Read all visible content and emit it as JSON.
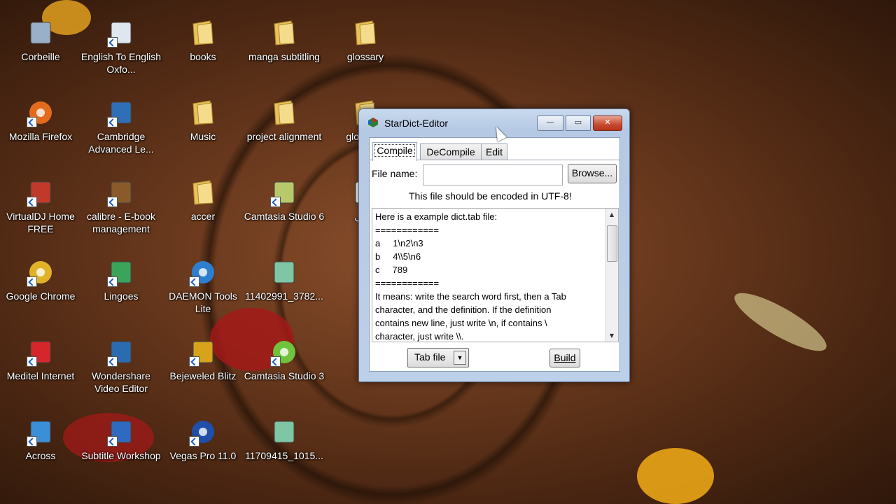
{
  "desktop": {
    "icons": [
      {
        "label": "Corbeille",
        "icon": "recycle-bin-icon",
        "shortcut": false
      },
      {
        "label": "English To English Oxfo...",
        "icon": "dictionary-icon",
        "shortcut": true
      },
      {
        "label": "books",
        "icon": "folder-icon",
        "shortcut": false
      },
      {
        "label": "manga subtitling",
        "icon": "folder-icon",
        "shortcut": false
      },
      {
        "label": "glossary",
        "icon": "folder-icon",
        "shortcut": false
      },
      {
        "label": "Mozilla Firefox",
        "icon": "firefox-icon",
        "shortcut": true
      },
      {
        "label": "Cambridge Advanced Le...",
        "icon": "cald3-icon",
        "shortcut": true
      },
      {
        "label": "Music",
        "icon": "folder-icon",
        "shortcut": false
      },
      {
        "label": "project alignment",
        "icon": "folder-icon",
        "shortcut": false
      },
      {
        "label": "glo assig",
        "icon": "folder-icon",
        "shortcut": false
      },
      {
        "label": "VirtualDJ Home FREE",
        "icon": "virtualdj-icon",
        "shortcut": true
      },
      {
        "label": "calibre - E-book management",
        "icon": "calibre-icon",
        "shortcut": true
      },
      {
        "label": "accer",
        "icon": "folder-icon",
        "shortcut": false
      },
      {
        "label": "Camtasia Studio 6",
        "icon": "camtasia-icon",
        "shortcut": true
      },
      {
        "label": "عربي",
        "icon": "file-icon",
        "shortcut": false
      },
      {
        "label": "Google Chrome",
        "icon": "chrome-icon",
        "shortcut": true
      },
      {
        "label": "Lingoes",
        "icon": "lingoes-icon",
        "shortcut": true
      },
      {
        "label": "DAEMON Tools Lite",
        "icon": "daemon-tools-icon",
        "shortcut": true
      },
      {
        "label": "11402991_3782...",
        "icon": "image-file-icon",
        "shortcut": false
      },
      {
        "label": "Meditel Internet",
        "icon": "meditel-icon",
        "shortcut": true
      },
      {
        "label": "Wondershare Video Editor",
        "icon": "wondershare-icon",
        "shortcut": true
      },
      {
        "label": "Bejeweled Blitz",
        "icon": "bejeweled-icon",
        "shortcut": true
      },
      {
        "label": "Camtasia Studio 3",
        "icon": "camtasia-green-icon",
        "shortcut": true
      },
      {
        "label": "Across",
        "icon": "across-icon",
        "shortcut": true
      },
      {
        "label": "Subtitle Workshop",
        "icon": "subtitle-workshop-icon",
        "shortcut": true
      },
      {
        "label": "Vegas Pro 11.0",
        "icon": "vegas-icon",
        "shortcut": true
      },
      {
        "label": "11709415_1015...",
        "icon": "image-file-icon",
        "shortcut": false
      }
    ]
  },
  "window": {
    "title": "StarDict-Editor",
    "minimize": "—",
    "maximize": "▭",
    "close": "✕",
    "tabs": [
      "Compile",
      "DeCompile",
      "Edit"
    ],
    "file_name_label": "File name:",
    "file_name_value": "",
    "browse_label": "Browse...",
    "encoding_note": "This file should be encoded in UTF-8!",
    "text_lines": [
      "Here is a example dict.tab file:",
      "============",
      "a     1\\n2\\n3",
      "b     4\\\\5\\n6",
      "c     789",
      "============",
      "It means: write the search word first, then a Tab",
      "character, and the definition. If the definition",
      "contains new line, just write \\n, if contains \\",
      "character, just write \\\\."
    ],
    "format_selected": "Tab file",
    "build_label": "Build"
  }
}
